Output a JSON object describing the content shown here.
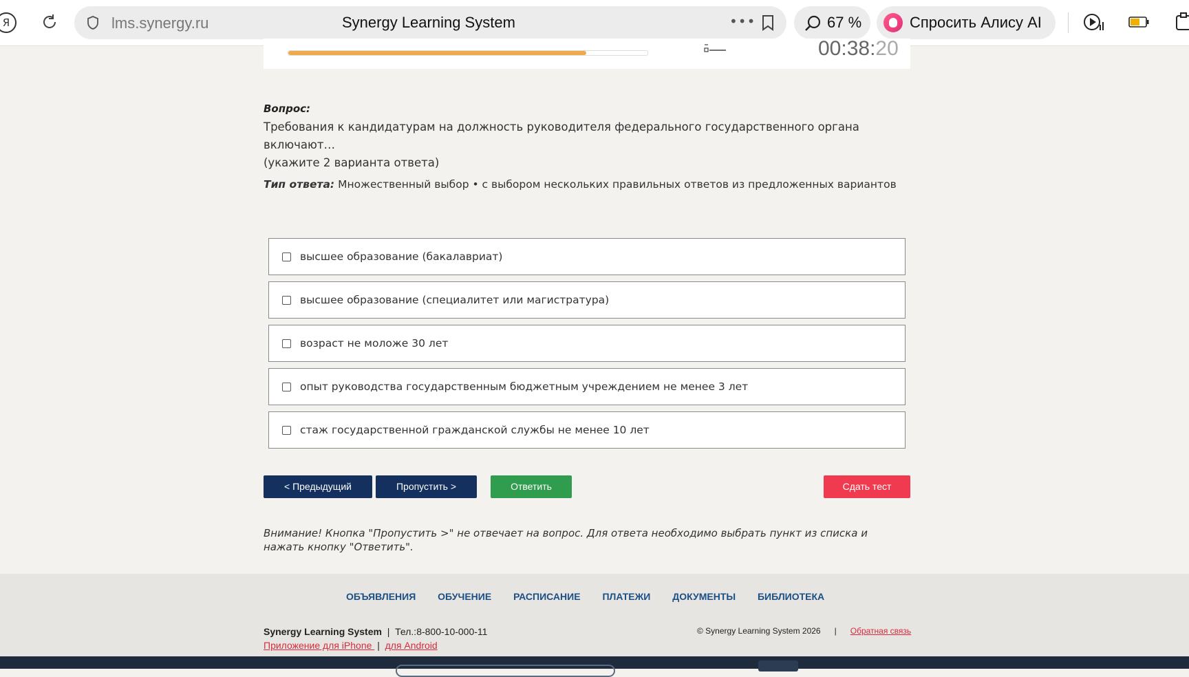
{
  "browser": {
    "url": "lms.synergy.ru",
    "page_title": "Synergy Learning System",
    "zoom": "67 %",
    "alice_label": "Спросить Алису AI",
    "yandex_glyph": "Я"
  },
  "test": {
    "progress_fraction": 0.83,
    "timer_main": "00:38:",
    "timer_seconds": "20"
  },
  "question": {
    "label": "Вопрос:",
    "line1": "Требования к кандидатурам на должность руководителя федерального государственного органа включают…",
    "line2": "(укажите 2 варианта ответа)",
    "answer_type_label": "Тип ответа:",
    "answer_type": " Множественный выбор • с выбором нескольких правильных ответов из предложенных вариантов"
  },
  "options": [
    {
      "text": "высшее образование (бакалавриат)",
      "checked": false
    },
    {
      "text": "высшее образование (специалитет или магистратура)",
      "checked": false
    },
    {
      "text": "возраст не моложе 30 лет",
      "checked": false
    },
    {
      "text": "опыт руководства государственным бюджетным учреждением не менее 3 лет",
      "checked": false
    },
    {
      "text": "стаж государственной гражданской службы не менее 10 лет",
      "checked": false
    }
  ],
  "buttons": {
    "prev": "< Предыдущий",
    "skip": "Пропустить >",
    "answer": "Ответить",
    "submit": "Сдать тест"
  },
  "note": "Внимание! Кнопка \"Пропустить >\" не отвечает на вопрос. Для ответа необходимо выбрать пункт из списка и нажать кнопку \"Ответить\".",
  "footer": {
    "nav": [
      "ОБЪЯВЛЕНИЯ",
      "ОБУЧЕНИЕ",
      "РАСПИСАНИЕ",
      "ПЛАТЕЖИ",
      "ДОКУМЕНТЫ",
      "БИБЛИОТЕКА"
    ],
    "brand": "Synergy Learning System",
    "separator": "|",
    "phone": "Тел.:8-800-10-000-11",
    "app_iphone": "Приложение для iPhone ",
    "app_android": "для Android",
    "copyright": "© Synergy Learning System 2026",
    "feedback": "Обратная связь"
  },
  "colors": {
    "primary_button": "#13305e",
    "answer_button": "#2f9d4d",
    "submit_button": "#ef3a4f",
    "progress": "#f0a94a",
    "footer_link": "#1c4f86"
  }
}
